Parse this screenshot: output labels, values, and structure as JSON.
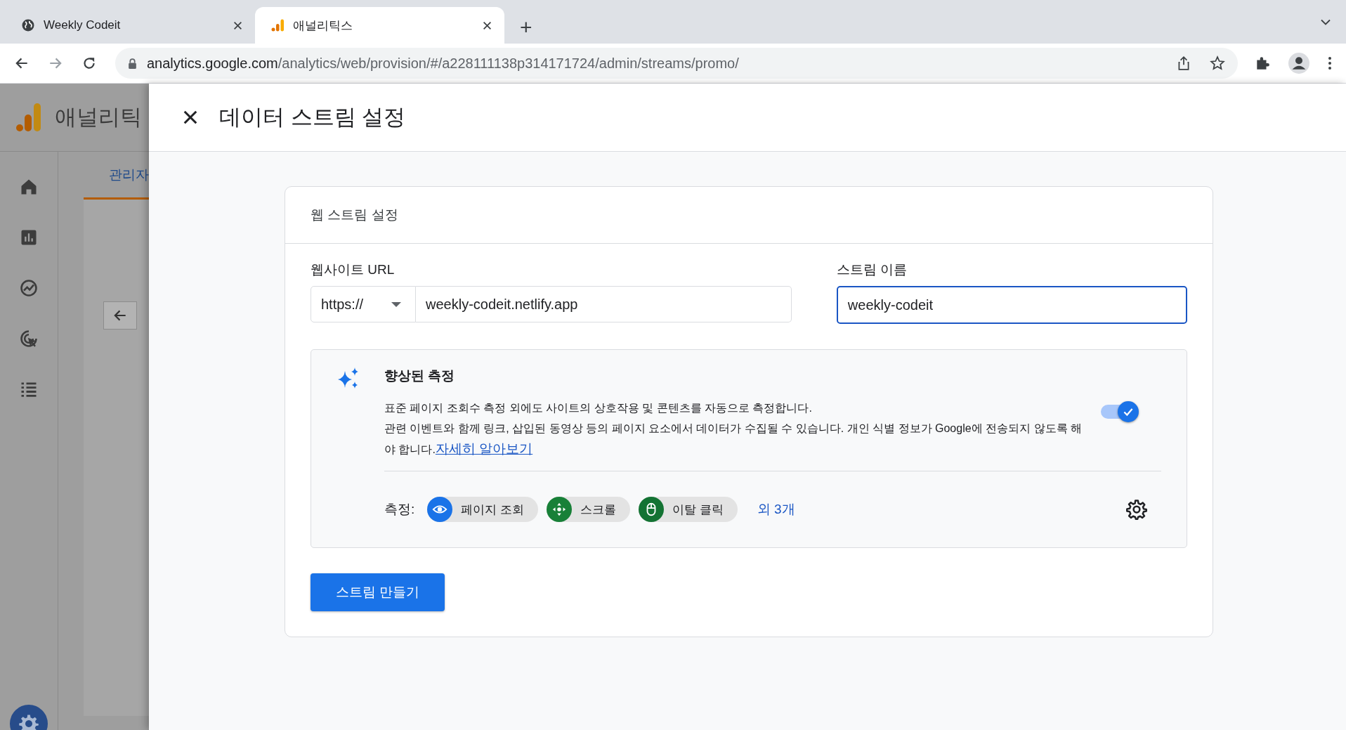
{
  "browser": {
    "tabs": [
      {
        "title": "Weekly Codeit",
        "selected": false
      },
      {
        "title": "애널리틱스",
        "selected": true
      }
    ],
    "new_tab": "+",
    "url_host": "analytics.google.com",
    "url_path": "/analytics/web/provision/#/a228111138p314171724/admin/streams/promo/"
  },
  "app": {
    "title": "애널리틱",
    "nav": [
      {
        "selected": false
      },
      {
        "selected": false
      },
      {
        "selected": false
      },
      {
        "selected": false
      },
      {
        "selected": false
      }
    ],
    "admin_tab": "관리자"
  },
  "panel": {
    "title": "데이터 스트림 설정",
    "card_title": "웹 스트림 설정",
    "url_label": "웹사이트 URL",
    "protocol": "https://",
    "url_value": "weekly-codeit.netlify.app",
    "name_label": "스트림 이름",
    "name_value": "weekly-codeit",
    "enhanced": {
      "title": "향상된 측정",
      "on": true,
      "description": "표준 페이지 조회수 측정 외에도 사이트의 상호작용 및 콘텐츠를 자동으로 측정합니다.",
      "description_2": "관련 이벤트와 함께 링크, 삽입된 동영상 등의 페이지 요소에서 데이터가 수집될 수 있습니다. 개인 식별 정보가 Google에 전송되지 않도록 해야 합니다.",
      "link": "자세히 알아보기",
      "measures_label": "측정:",
      "measures": [
        {
          "label": "페이지 조회",
          "kind": "eye",
          "color": "#1a73e8"
        },
        {
          "label": "스크롤",
          "kind": "scroll",
          "color": "#188038"
        },
        {
          "label": "이탈 클릭",
          "kind": "mouse",
          "color": "#137333"
        }
      ],
      "more": "외 3개"
    },
    "create_button": "스트림 만들기"
  }
}
